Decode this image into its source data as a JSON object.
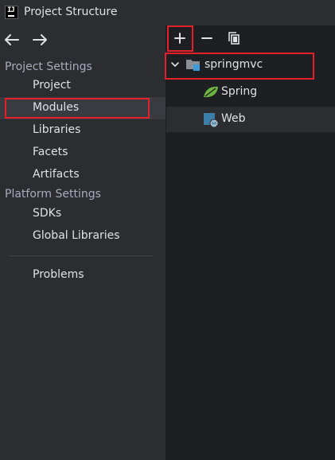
{
  "window": {
    "title": "Project Structure"
  },
  "nav": {
    "project_settings_header": "Project Settings",
    "project_settings_items": [
      {
        "label": "Project"
      },
      {
        "label": "Modules",
        "selected": true
      },
      {
        "label": "Libraries"
      },
      {
        "label": "Facets"
      },
      {
        "label": "Artifacts"
      }
    ],
    "platform_settings_header": "Platform Settings",
    "platform_settings_items": [
      {
        "label": "SDKs"
      },
      {
        "label": "Global Libraries"
      }
    ],
    "problems_label": "Problems"
  },
  "toolbar": {
    "add_icon": "plus-icon",
    "remove_icon": "minus-icon",
    "copy_icon": "copy-icon"
  },
  "tree": {
    "module": {
      "label": "springmvc",
      "expanded": true,
      "icon": "module-folder-icon"
    },
    "facets": [
      {
        "label": "Spring",
        "icon": "spring-leaf-icon"
      },
      {
        "label": "Web",
        "icon": "web-facet-icon"
      }
    ]
  },
  "colors": {
    "background": "#2b2d30",
    "tree_background": "#1e1f22",
    "selection": "#393b40",
    "annotation_red": "#e4202a",
    "spring_green": "#6db33f",
    "folder_blue": "#3d9bd9"
  }
}
